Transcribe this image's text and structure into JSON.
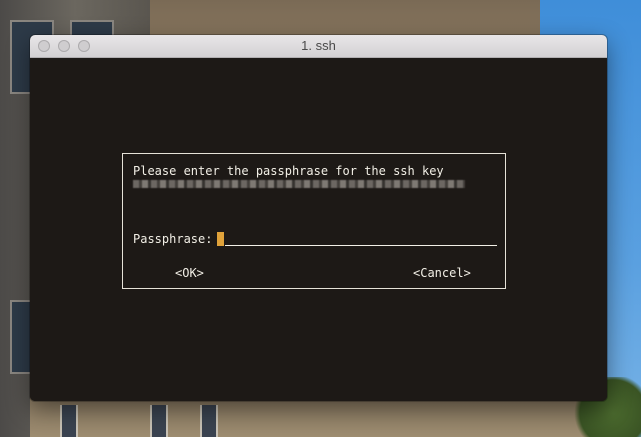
{
  "window": {
    "title": "1. ssh"
  },
  "dialog": {
    "prompt": "Please enter the passphrase for the ssh key",
    "passphrase_label": "Passphrase:",
    "passphrase_value": "",
    "ok_label": "<OK>",
    "cancel_label": "<Cancel>"
  },
  "colors": {
    "terminal_bg": "#1d1916",
    "dialog_text": "#f2efe6",
    "cursor": "#e0a23a",
    "titlebar": "#e3e1e3"
  }
}
